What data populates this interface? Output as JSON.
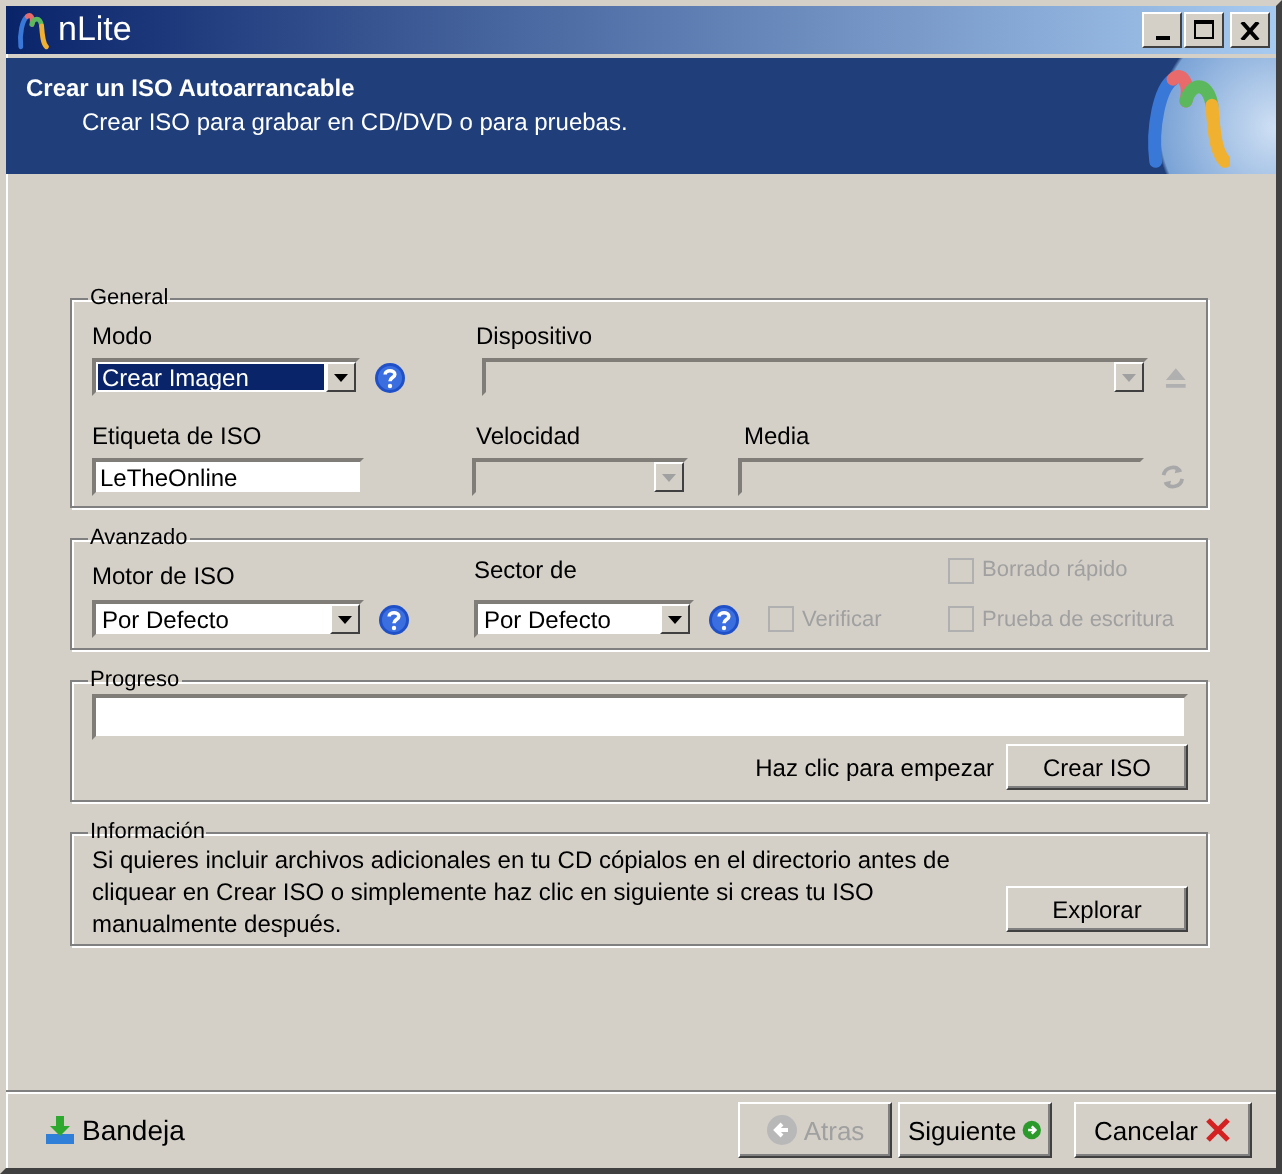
{
  "window": {
    "title": "nLite"
  },
  "header": {
    "title": "Crear un ISO Autoarrancable",
    "subtitle": "Crear ISO para grabar en CD/DVD o para pruebas."
  },
  "general": {
    "legend": "General",
    "mode": {
      "label": "Modo",
      "value": "Crear Imagen",
      "highlighted": true,
      "disabled": false
    },
    "device": {
      "label": "Dispositivo",
      "disabled": true
    },
    "iso_label": {
      "label": "Etiqueta de ISO",
      "value": "LeTheOnline"
    },
    "speed": {
      "label": "Velocidad",
      "disabled": true
    },
    "media": {
      "label": "Media",
      "disabled": true
    }
  },
  "advanced": {
    "legend": "Avanzado",
    "engine": {
      "label": "Motor de ISO",
      "value": "Por Defecto",
      "highlighted": false,
      "disabled": false
    },
    "sector": {
      "label": "Sector de",
      "value": "Por Defecto",
      "highlighted": false,
      "disabled": false
    },
    "checkboxes": [
      {
        "label": "Borrado rápido",
        "checked": false,
        "disabled": true
      },
      {
        "label": "Verificar",
        "checked": false,
        "disabled": true
      },
      {
        "label": "Prueba de escritura",
        "checked": false,
        "disabled": true
      }
    ]
  },
  "progress": {
    "legend": "Progreso",
    "level": 0,
    "hint": "Haz clic para empezar",
    "button": "Crear ISO"
  },
  "info": {
    "legend": "Información",
    "text": "Si quieres incluir archivos adicionales en tu CD cópialos en el directorio antes de cliquear en Crear ISO o simplemente haz clic en siguiente si creas tu ISO manualmente después.",
    "button": "Explorar"
  },
  "footer": {
    "tray": "Bandeja",
    "buttons": [
      {
        "kind": "back",
        "label": "Atras",
        "disabled": true
      },
      {
        "kind": "next",
        "label": "Siguiente",
        "disabled": false
      },
      {
        "kind": "cancel",
        "label": "Cancelar",
        "disabled": false
      }
    ]
  }
}
